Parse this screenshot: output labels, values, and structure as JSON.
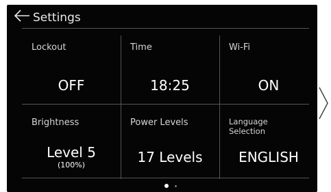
{
  "header": {
    "title": "Settings",
    "back_icon": "back-arrow-icon"
  },
  "tiles": [
    {
      "label": "Lockout",
      "value": "OFF"
    },
    {
      "label": "Time",
      "value": "18:25"
    },
    {
      "label": "Wi-Fi",
      "value": "ON"
    },
    {
      "label": "Brightness",
      "value": "Level 5",
      "sub": "(100%)"
    },
    {
      "label": "Power Levels",
      "value": "17 Levels"
    },
    {
      "label": "Language\nSelection",
      "value": "ENGLISH"
    }
  ],
  "pager": {
    "pages": 2,
    "active_page": 1
  },
  "next_icon": "chevron-right-icon",
  "colors": {
    "background": "#050505",
    "text": "#ffffff",
    "divider": "#555555",
    "dot_active": "#ffffff",
    "dot_inactive": "#7a7a7a"
  }
}
